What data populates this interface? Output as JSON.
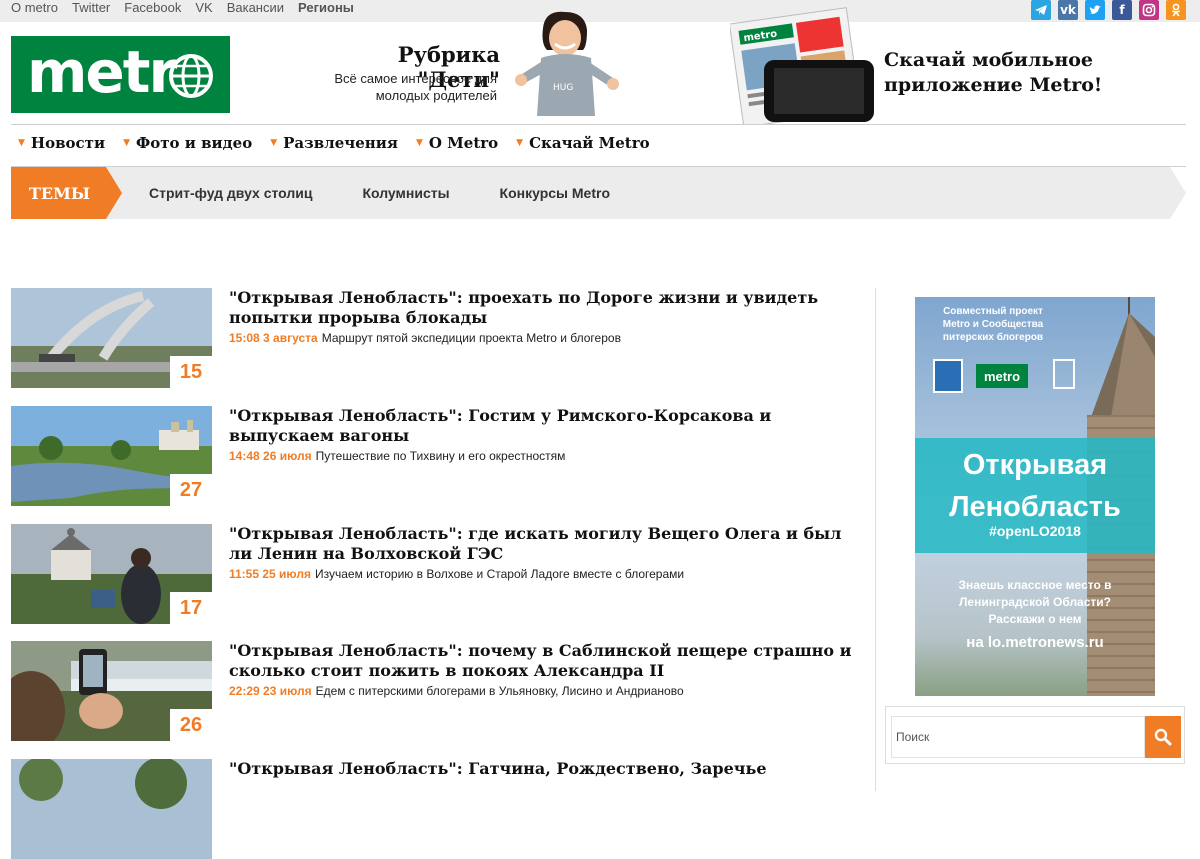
{
  "topbar": {
    "links": [
      "О metro",
      "Twitter",
      "Facebook",
      "VK",
      "Вакансии",
      "Регионы"
    ],
    "social_icons": [
      "telegram-icon",
      "vk-icon",
      "twitter-icon",
      "facebook-icon",
      "instagram-icon",
      "odnoklassniki-icon"
    ],
    "social_colors": [
      "#2ca5e0",
      "#4a76a8",
      "#1da1f2",
      "#3b5998",
      "#c13584",
      "#f7931e"
    ]
  },
  "header": {
    "logo_text": "metr",
    "promo_kids_title": "Рубрика \"Дети\"",
    "promo_kids_subtitle": "Всё самое интересное для молодых родителей",
    "promo_app_text": "Скачай мобильное приложение Metro!"
  },
  "nav": {
    "items": [
      "Новости",
      "Фото и видео",
      "Развлечения",
      "О Metro",
      "Скачай Metro"
    ]
  },
  "themes": {
    "label": "ТЕМЫ",
    "links": [
      "Стрит-фуд двух столиц",
      "Колумнисты",
      "Конкурсы Metro"
    ]
  },
  "articles": [
    {
      "title": "\"Открывая Ленобласть\": проехать по Дороге жизни и увидеть попытки прорыва блокады",
      "time": "15:08 3 августа",
      "desc": "Маршрут пятой экспедиции проекта Metro и блогеров",
      "count": "15"
    },
    {
      "title": "\"Открывая Ленобласть\": Гостим у Римского-Корсакова и выпускаем вагоны",
      "time": "14:48 26 июля",
      "desc": "Путешествие по Тихвину и его окрестностям",
      "count": "27"
    },
    {
      "title": "\"Открывая Ленобласть\": где искать могилу Вещего Олега и был ли Ленин на Волховской ГЭС",
      "time": "11:55 25 июля",
      "desc": "Изучаем историю в Волхове и Старой Ладоге вместе с блогерами",
      "count": "17"
    },
    {
      "title": "\"Открывая Ленобласть\": почему в Саблинской пещере страшно и сколько стоит пожить в покоях Александра II",
      "time": "22:29 23 июля",
      "desc": "Едем с питерскими блогерами в Ульяновку, Лисино и Андрианово",
      "count": "26"
    },
    {
      "title": "\"Открывая Ленобласть\": Гатчина, Рождествено, Заречье",
      "time": "",
      "desc": "",
      "count": ""
    }
  ],
  "banner": {
    "top_text": "Совместный проект Metro и Сообщества питерских блогеров",
    "mini_logo": "metro",
    "title_line1": "Открывая",
    "title_line2": "Ленобласть",
    "hashtag": "#openLO2018",
    "question": "Знаешь классное место в Ленинградской Области? Расскажи о нем",
    "url": "на lo.metronews.ru"
  },
  "search": {
    "placeholder": "Поиск"
  },
  "colors": {
    "brand_green": "#00833e",
    "accent_orange": "#f07d26"
  }
}
